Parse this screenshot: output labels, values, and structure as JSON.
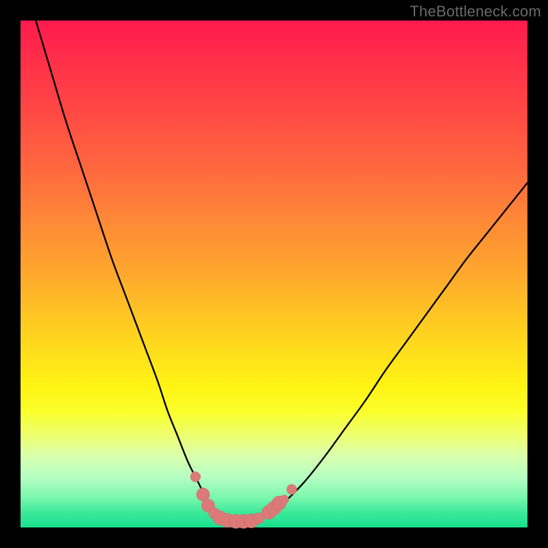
{
  "watermark": "TheBottleneck.com",
  "colors": {
    "frame_bg": "#000000",
    "curve_stroke": "#000000",
    "marker_fill": "#db7a78",
    "marker_stroke": "#d06a67"
  },
  "chart_data": {
    "type": "line",
    "title": "",
    "xlabel": "",
    "ylabel": "",
    "xlim": [
      0,
      100
    ],
    "ylim": [
      0,
      100
    ],
    "series": [
      {
        "name": "bottleneck-curve",
        "x": [
          3,
          6,
          9,
          12,
          15,
          18,
          21,
          24,
          27,
          29,
          31,
          33,
          35,
          36.5,
          38,
          39.5,
          41,
          43,
          45,
          48,
          52,
          56,
          60,
          64,
          68,
          72,
          76,
          80,
          84,
          88,
          92,
          96,
          100
        ],
        "y": [
          100,
          90,
          80,
          71,
          62,
          53,
          45,
          37,
          29,
          23,
          18,
          13,
          9,
          6,
          4,
          2.5,
          1.6,
          1.2,
          1.2,
          2.2,
          5,
          9,
          14,
          19.5,
          25,
          31,
          36.5,
          42,
          47.5,
          53,
          58,
          63,
          68
        ]
      }
    ],
    "markers": [
      {
        "x": 34.5,
        "y": 10,
        "r": 1.0
      },
      {
        "x": 36.0,
        "y": 6.5,
        "r": 1.3
      },
      {
        "x": 37.0,
        "y": 4.3,
        "r": 1.3
      },
      {
        "x": 38.2,
        "y": 2.8,
        "r": 1.1
      },
      {
        "x": 39.3,
        "y": 1.9,
        "r": 1.4
      },
      {
        "x": 40.8,
        "y": 1.4,
        "r": 1.4
      },
      {
        "x": 42.5,
        "y": 1.2,
        "r": 1.4
      },
      {
        "x": 44.0,
        "y": 1.2,
        "r": 1.4
      },
      {
        "x": 45.5,
        "y": 1.3,
        "r": 1.4
      },
      {
        "x": 47.0,
        "y": 1.8,
        "r": 1.1
      },
      {
        "x": 49.0,
        "y": 3.0,
        "r": 1.4
      },
      {
        "x": 50.0,
        "y": 3.8,
        "r": 1.4
      },
      {
        "x": 51.0,
        "y": 4.8,
        "r": 1.4
      },
      {
        "x": 52.0,
        "y": 5.5,
        "r": 0.9
      },
      {
        "x": 53.5,
        "y": 7.5,
        "r": 1.0
      }
    ]
  }
}
